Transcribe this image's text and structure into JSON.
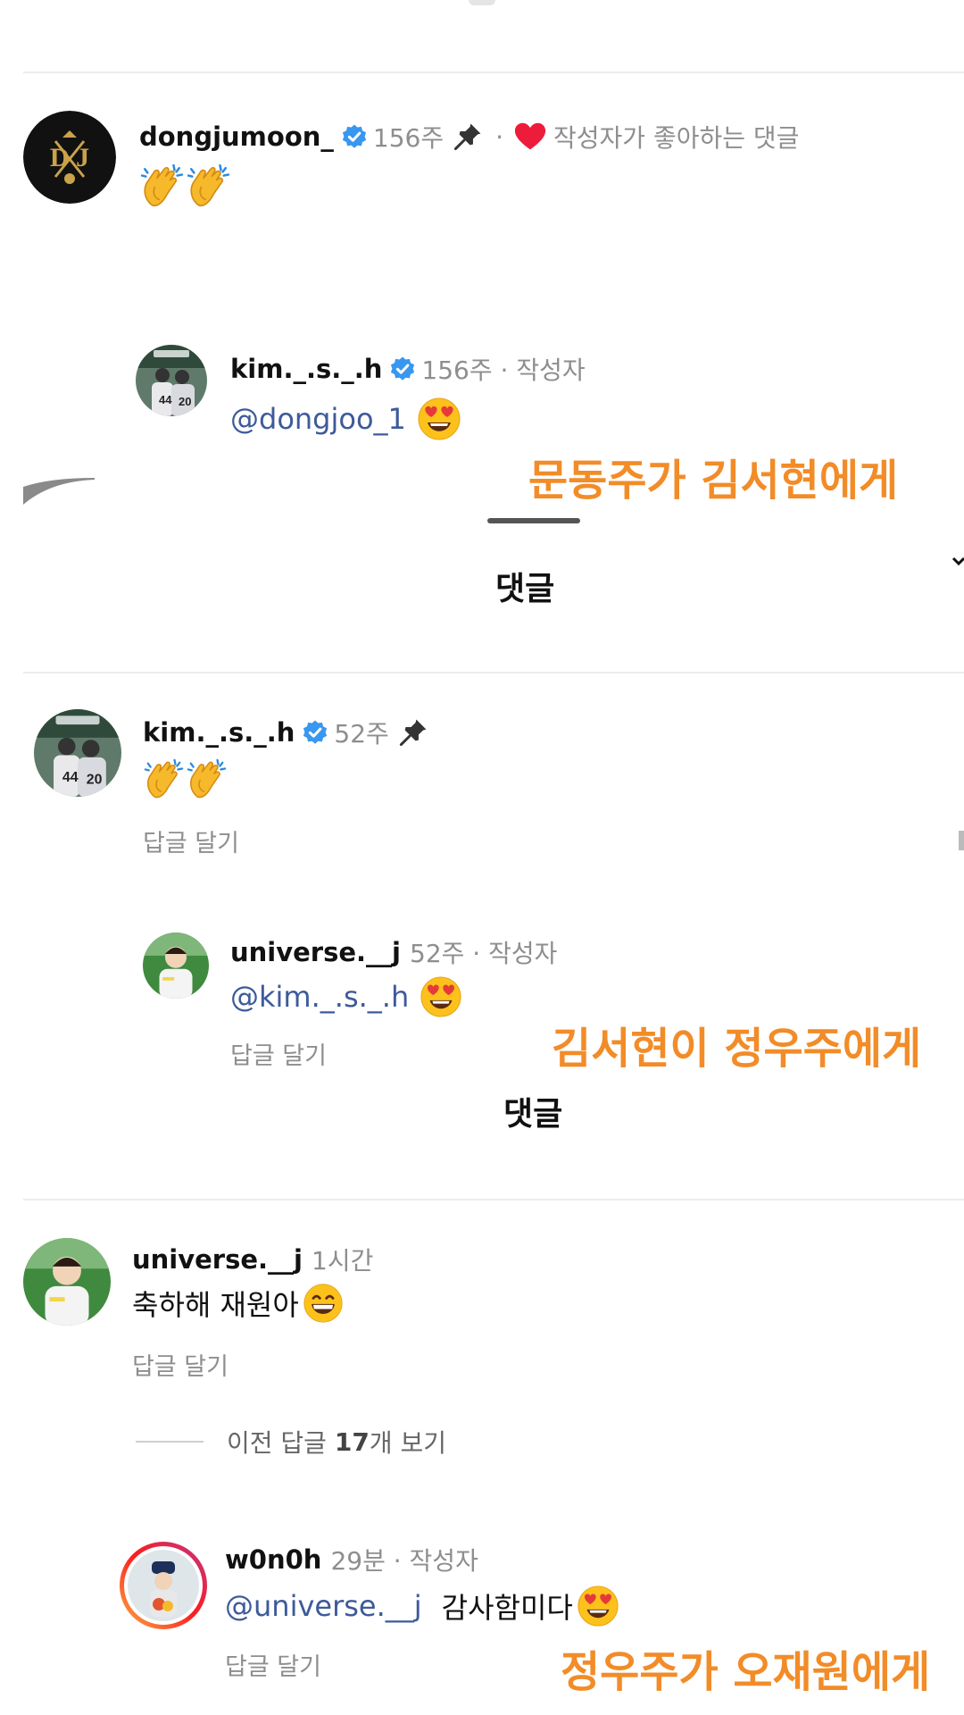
{
  "comments": [
    {
      "username": "dongjumoon_",
      "time": "156주",
      "separator": "·",
      "liked_label": "작성자가 좋아하는 댓글",
      "text_emoji": "clapping-hands x2"
    },
    {
      "username": "kim._.s._.h",
      "meta": "156주 · 작성자",
      "mention": "@dongjoo_1",
      "text_emoji": "heart-eyes"
    },
    {
      "username": "kim._.s._.h",
      "time": "52주",
      "text_emoji": "clapping-hands x2",
      "reply_label": "답글 달기"
    },
    {
      "username": "universe.__j",
      "meta": "52주 · 작성자",
      "mention": "@kim._.s._.h",
      "text_emoji": "heart-eyes",
      "reply_label": "답글 달기"
    },
    {
      "username": "universe.__j",
      "meta": "1시간",
      "text": "축하해 재원아",
      "text_emoji": "grinning",
      "reply_label": "답글 달기"
    },
    {
      "username": "w0n0h",
      "meta": "29분 · 작성자",
      "mention": "@universe.__j",
      "text": "감사함미다",
      "text_emoji": "heart-eyes",
      "reply_label": "답글 달기"
    }
  ],
  "sheet_title_1": "댓글",
  "sheet_title_2": "댓글",
  "view_previous": {
    "prefix": "이전 답글 ",
    "count": "17",
    "suffix": "개 보기"
  },
  "annotations": {
    "a1": "문동주가 김서현에게",
    "a2": "김서현이 정우주에게",
    "a3": "정우주가 오재원에게"
  },
  "colors": {
    "annotation": "#f28c28",
    "mention": "#3d5a9b",
    "verified": "#3897f0",
    "heart": "#ed1c3a",
    "meta": "#8e8e8e"
  },
  "icons": [
    "verified-badge-icon",
    "pin-icon",
    "heart-icon",
    "clapping-hands-emoji",
    "heart-eyes-emoji",
    "grinning-emoji"
  ]
}
